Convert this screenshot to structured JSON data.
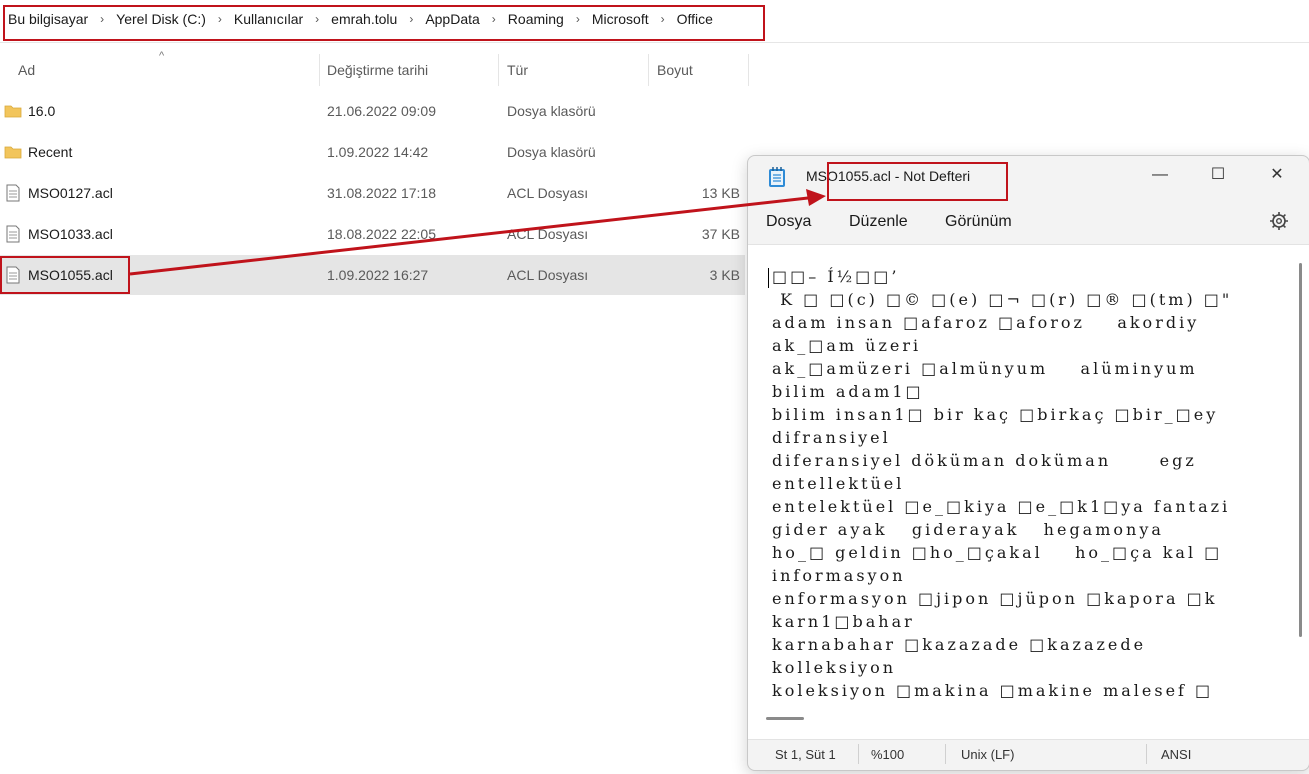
{
  "explorer": {
    "breadcrumb": [
      "Bu bilgisayar",
      "Yerel Disk (C:)",
      "Kullanıcılar",
      "emrah.tolu",
      "AppData",
      "Roaming",
      "Microsoft",
      "Office"
    ],
    "breadcrumb_separator": "›",
    "columns": {
      "name": "Ad",
      "modified": "Değiştirme tarihi",
      "type": "Tür",
      "size": "Boyut"
    },
    "files": [
      {
        "name": "16.0",
        "modified": "21.06.2022 09:09",
        "type": "Dosya klasörü",
        "size": "",
        "icon": "folder-icon"
      },
      {
        "name": "Recent",
        "modified": "1.09.2022 14:42",
        "type": "Dosya klasörü",
        "size": "",
        "icon": "folder-icon"
      },
      {
        "name": "MSO0127.acl",
        "modified": "31.08.2022 17:18",
        "type": "ACL Dosyası",
        "size": "13 KB",
        "icon": "file-icon"
      },
      {
        "name": "MSO1033.acl",
        "modified": "18.08.2022 22:05",
        "type": "ACL Dosyası",
        "size": "37 KB",
        "icon": "file-icon"
      },
      {
        "name": "MSO1055.acl",
        "modified": "1.09.2022 16:27",
        "type": "ACL Dosyası",
        "size": "3 KB",
        "icon": "file-icon",
        "selected": true
      }
    ]
  },
  "notepad": {
    "title": "MSO1055.acl - Not Defteri",
    "controls": {
      "minimize": "—",
      "maximize": "☐",
      "close": "✕"
    },
    "menu": {
      "file": "Dosya",
      "edit": "Düzenle",
      "view": "Görünüm"
    },
    "content": "□□– Í½□□’\n K □ □(c) □© □(e) □¬ □(r) □® □(tm) □\"\nadam insan □afaroz □aforoz    akordiy\nak_□am üzeri\nak_□amüzeri □almünyum    alüminyum\nbilim adam1□\nbilim insan1□ bir kaç □birkaç □bir_□ey\ndifransiyel\ndiferansiyel döküman doküman      egz\nentellektüel\nentelektüel □e_□kiya □e_□k1□ya fantazi\ngider ayak   giderayak   hegamonya\nho_□ geldin □ho_□çakal    ho_□ça kal □\ninformasyon\nenformasyon □jipon □jüpon □kapora □k\nkarn1□bahar\nkarnabahar □kazazade □kazazede\nkolleksiyon\nkoleksiyon □makina □makine malesef □",
    "status": {
      "position": "St 1, Süt 1",
      "zoom": "%100",
      "line_ending": "Unix (LF)",
      "encoding": "ANSI"
    }
  },
  "colors": {
    "highlight": "#c0131b",
    "folder": "#f2c55c",
    "selection": "#e5e5e5"
  }
}
